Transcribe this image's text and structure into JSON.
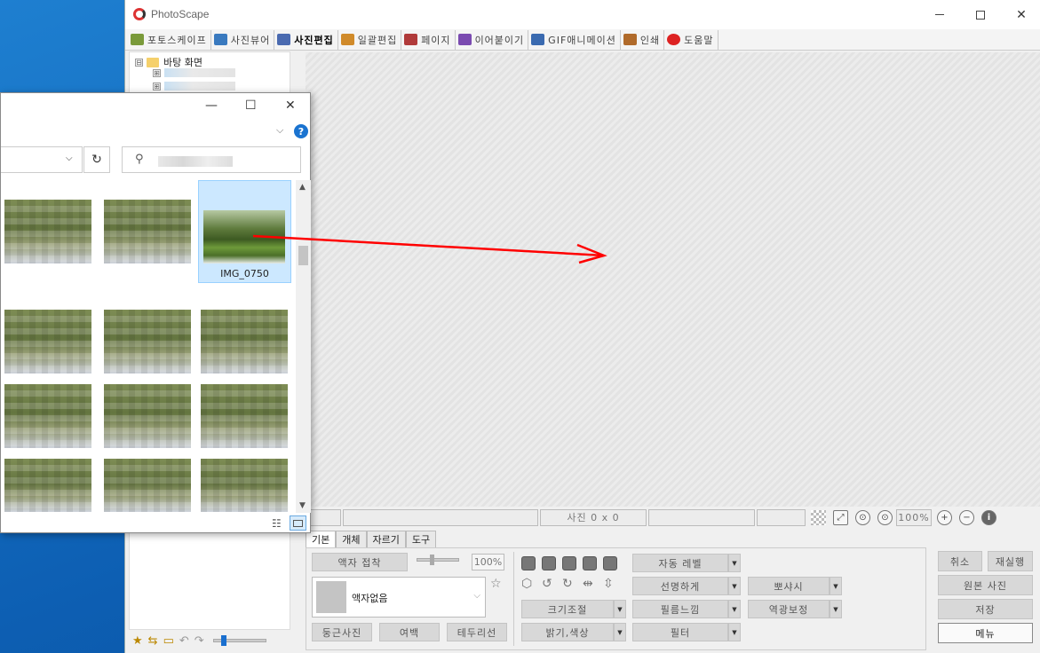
{
  "photoscape": {
    "title": "PhotoScape",
    "tabs": [
      {
        "label": "포토스케이프",
        "color": "#7a9a3a"
      },
      {
        "label": "사진뷰어",
        "color": "#3a7abf"
      },
      {
        "label": "사진편집",
        "color": "#4a6ab0",
        "active": true
      },
      {
        "label": "일괄편집",
        "color": "#d08a2a"
      },
      {
        "label": "페이지",
        "color": "#b03a3a"
      },
      {
        "label": "이어붙이기",
        "color": "#7a4ab0"
      },
      {
        "label": "GIF애니메이션",
        "color": "#3a6ab0"
      },
      {
        "label": "인쇄",
        "color": "#b06a2a"
      },
      {
        "label": "도움말",
        "color": "#d22"
      }
    ],
    "tree": {
      "root_label": "바탕 화면",
      "expander": "⊟",
      "child_expander": "⊞"
    },
    "status": {
      "size_text": "사진 0 x 0",
      "zoom": "100%"
    },
    "edit_tabs": [
      "기본",
      "개체",
      "자르기",
      "도구"
    ],
    "basic": {
      "frame_attach": "액자 접착",
      "frame_percent": "100%",
      "frame_name": "액자없음",
      "round_photo": "둥근사진",
      "margin": "여백",
      "border": "테두리선",
      "resize": "크기조절",
      "brightness": "밝기,색상",
      "auto_level": "자동 레벨",
      "sharpen": "선명하게",
      "film": "필름느낌",
      "filter": "필터",
      "dehaze": "뽀샤시",
      "backlight": "역광보정"
    },
    "right_buttons": {
      "undo": "취소",
      "redo": "재실행",
      "original": "원본 사진",
      "save": "저장",
      "menu": "메뉴"
    }
  },
  "explorer": {
    "selected_file": "IMG_0750",
    "search_icon": "search-icon",
    "help_label": "?"
  }
}
